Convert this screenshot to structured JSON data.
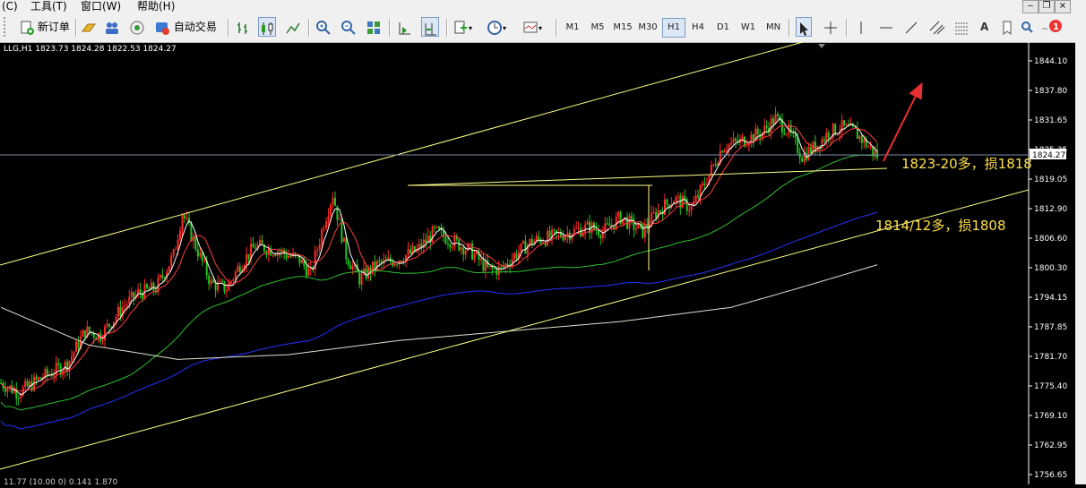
{
  "menubar": {
    "items": [
      "(C)",
      "工具(T)",
      "窗口(W)",
      "帮助(H)"
    ]
  },
  "toolbar": {
    "new_order": "新订单",
    "auto_trade": "自动交易",
    "timeframes": [
      "M1",
      "M5",
      "M15",
      "M30",
      "H1",
      "H4",
      "D1",
      "W1",
      "MN"
    ],
    "active_timeframe": "H1",
    "notification_count": "1",
    "text_tool": "A"
  },
  "chart": {
    "title": "LLG,H1  1823.73 1824.28 1822.53 1824.27",
    "current_price": "1824.27",
    "price_labels": [
      "1844.10",
      "1837.80",
      "1831.65",
      "1825.35",
      "1819.05",
      "1812.90",
      "1806.60",
      "1800.30",
      "1794.15",
      "1787.85",
      "1781.70",
      "1775.40",
      "1769.10",
      "1762.95",
      "1756.65"
    ],
    "annotations": {
      "upper": "1823-20多，损1818",
      "lower": "1814/12多，损1808"
    },
    "bottom_stat": "11.77 (10.00 0) 0.141 1.870",
    "colors": {
      "bull": "#ff2a2a",
      "bear": "#22c322",
      "ma_fast": "#ffffff",
      "ma_mid": "#ff3b3b",
      "ma_green": "#2dbf2d",
      "ma_blue": "#2233ff",
      "ma_slow": "#e0e0d0",
      "channel": "#ffff88",
      "arrow": "#e83030"
    }
  }
}
